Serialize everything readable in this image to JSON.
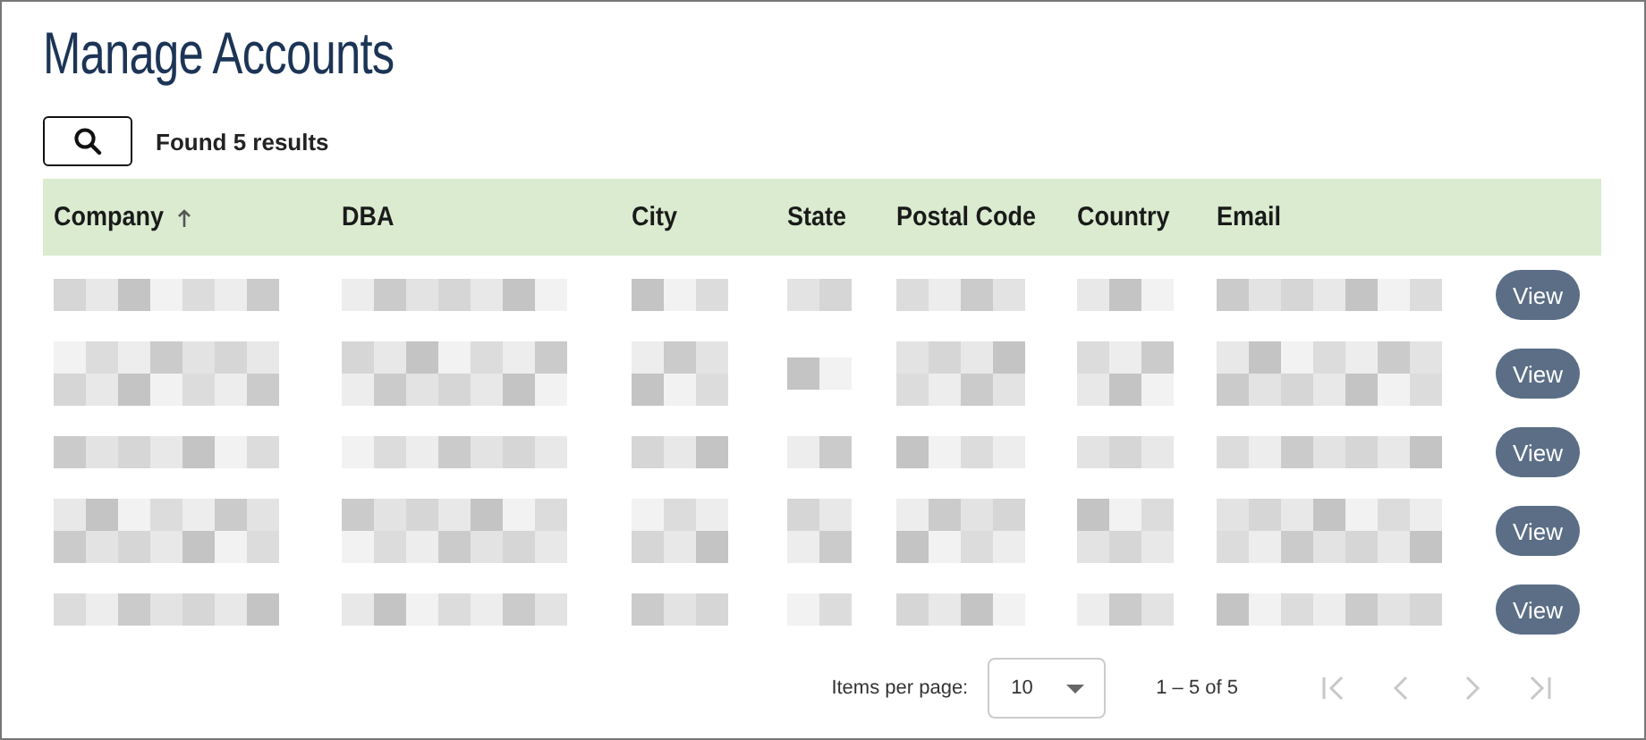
{
  "title": "Manage Accounts",
  "search": {
    "result_text": "Found 5 results"
  },
  "table": {
    "columns": [
      {
        "label": "Company",
        "sorted_ascending": true
      },
      {
        "label": "DBA",
        "sorted_ascending": false
      },
      {
        "label": "City",
        "sorted_ascending": false
      },
      {
        "label": "State",
        "sorted_ascending": false
      },
      {
        "label": "Postal Code",
        "sorted_ascending": false
      },
      {
        "label": "Country",
        "sorted_ascending": false
      },
      {
        "label": "Email",
        "sorted_ascending": false
      }
    ],
    "rows": [
      {
        "cells": [
          {
            "kind": "single"
          },
          {
            "kind": "single"
          },
          {
            "kind": "single"
          },
          {
            "kind": "single"
          },
          {
            "kind": "single"
          },
          {
            "kind": "single"
          },
          {
            "kind": "single"
          }
        ],
        "action": "View"
      },
      {
        "cells": [
          {
            "kind": "double"
          },
          {
            "kind": "double"
          },
          {
            "kind": "double"
          },
          {
            "kind": "single"
          },
          {
            "kind": "double"
          },
          {
            "kind": "double"
          },
          {
            "kind": "double"
          }
        ],
        "action": "View"
      },
      {
        "cells": [
          {
            "kind": "single"
          },
          {
            "kind": "single"
          },
          {
            "kind": "single"
          },
          {
            "kind": "single"
          },
          {
            "kind": "single"
          },
          {
            "kind": "single"
          },
          {
            "kind": "single"
          }
        ],
        "action": "View"
      },
      {
        "cells": [
          {
            "kind": "double"
          },
          {
            "kind": "double"
          },
          {
            "kind": "double"
          },
          {
            "kind": "double"
          },
          {
            "kind": "double"
          },
          {
            "kind": "double"
          },
          {
            "kind": "double"
          }
        ],
        "action": "View"
      },
      {
        "cells": [
          {
            "kind": "single"
          },
          {
            "kind": "single"
          },
          {
            "kind": "single"
          },
          {
            "kind": "single"
          },
          {
            "kind": "single"
          },
          {
            "kind": "single"
          },
          {
            "kind": "single"
          }
        ],
        "action": "View"
      }
    ]
  },
  "paginator": {
    "items_label": "Items per page:",
    "page_size": "10",
    "range": "1 – 5 of 5",
    "buttons": [
      {
        "kind": "first",
        "disabled": true
      },
      {
        "kind": "previous",
        "disabled": true
      },
      {
        "kind": "next",
        "disabled": true
      },
      {
        "kind": "last",
        "disabled": true
      }
    ]
  }
}
